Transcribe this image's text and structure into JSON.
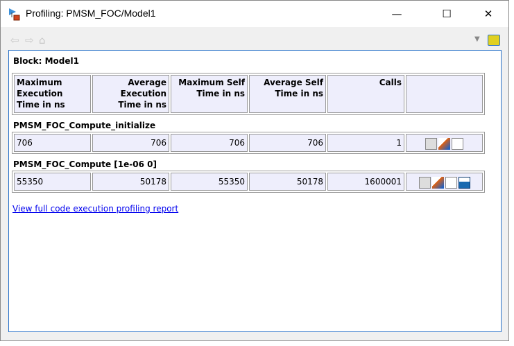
{
  "window": {
    "title": "Profiling: PMSM_FOC/Model1",
    "min": "—",
    "max": "☐",
    "close": "✕"
  },
  "toolbar": {
    "back": "⇦",
    "forward": "⇨",
    "home": "⌂",
    "dropdown": "▼"
  },
  "block_label": "Block: Model1",
  "headers": [
    "Maximum Execution Time in ns",
    "Average Execution Time in ns",
    "Maximum Self Time in ns",
    "Average Self Time in ns",
    "Calls",
    ""
  ],
  "sections": [
    {
      "name": "PMSM_FOC_Compute_initialize",
      "values": [
        "706",
        "706",
        "706",
        "706",
        "1"
      ],
      "icons": [
        "code-icon",
        "matlab-icon",
        "plot-icon"
      ]
    },
    {
      "name": "PMSM_FOC_Compute [1e-06 0]",
      "values": [
        "55350",
        "50178",
        "55350",
        "50178",
        "1600001"
      ],
      "icons": [
        "code-icon",
        "matlab-icon",
        "plot-icon",
        "histogram-icon"
      ]
    }
  ],
  "link": "View full code execution profiling report"
}
